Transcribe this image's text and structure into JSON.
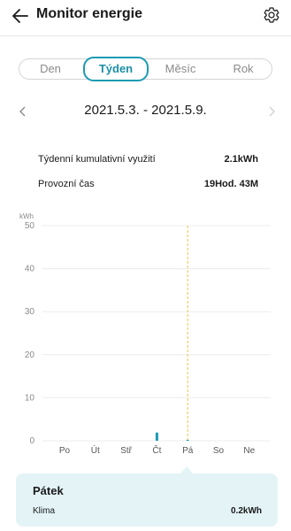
{
  "header": {
    "title": "Monitor energie",
    "back_icon": "arrow-left-icon",
    "settings_icon": "gear-icon"
  },
  "period_tabs": [
    {
      "label": "Den",
      "active": false
    },
    {
      "label": "Týden",
      "active": true
    },
    {
      "label": "Měsíc",
      "active": false
    },
    {
      "label": "Rok",
      "active": false
    }
  ],
  "date_nav": {
    "range": "2021.5.3. - 2021.5.9.",
    "prev_icon": "chevron-left-icon",
    "next_icon": "chevron-right-icon"
  },
  "stats": [
    {
      "label": "Týdenní kumulativní využití",
      "value": "2.1kWh"
    },
    {
      "label": "Provozní čas",
      "value": "19Hod. 43M"
    }
  ],
  "chart_data": {
    "type": "bar",
    "ylabel": "kWh",
    "ylim": [
      0,
      50
    ],
    "yticks": [
      0,
      10,
      20,
      30,
      40,
      50
    ],
    "categories": [
      "Po",
      "Út",
      "Stř",
      "Čt",
      "Pá",
      "So",
      "Ne"
    ],
    "values": [
      0,
      0,
      0,
      1.9,
      0.2,
      0,
      0
    ],
    "selected_index": 4,
    "bar_color": "#1a9bb3",
    "selected_line_color": "#e6c84a",
    "grid": true
  },
  "detail": {
    "day": "Pátek",
    "label": "Klima",
    "value": "0.2kWh"
  },
  "colors": {
    "accent": "#1a9bb3",
    "card_bg": "#e3f3f6"
  }
}
